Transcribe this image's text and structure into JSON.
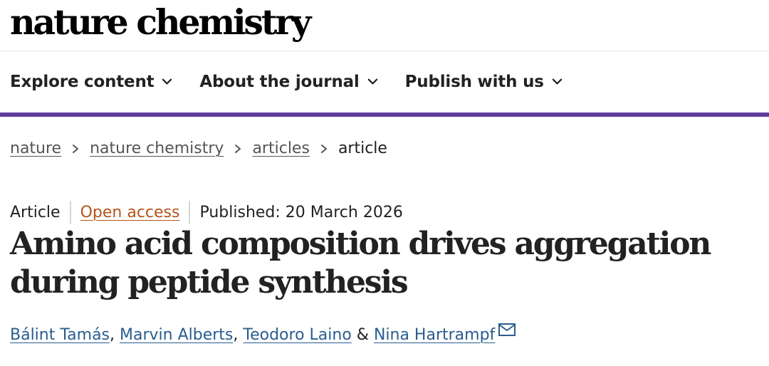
{
  "brand": {
    "logo_text": "nature chemistry"
  },
  "nav": {
    "items": [
      {
        "label": "Explore content",
        "icon": "chevron-down-icon"
      },
      {
        "label": "About the journal",
        "icon": "chevron-down-icon"
      },
      {
        "label": "Publish with us",
        "icon": "chevron-down-icon"
      }
    ],
    "accent_color": "#5f3f9c"
  },
  "breadcrumb": {
    "items": [
      "nature",
      "nature chemistry",
      "articles"
    ],
    "current": "article",
    "separator_icon": "chevron-right-icon"
  },
  "article": {
    "type": "Article",
    "access": "Open access",
    "access_color": "#b5541a",
    "published": "Published: 20 March 2026",
    "title": "Amino acid composition drives aggregation during peptide synthesis",
    "authors": [
      {
        "name": "Bálint Tamás",
        "sep": ", "
      },
      {
        "name": "Marvin Alberts",
        "sep": ", "
      },
      {
        "name": "Teodoro Laino",
        "sep": " & "
      },
      {
        "name": "Nina Hartrampf",
        "sep": ""
      }
    ],
    "corresponding_icon": "mail-icon",
    "author_link_color": "#2a5c8f"
  }
}
